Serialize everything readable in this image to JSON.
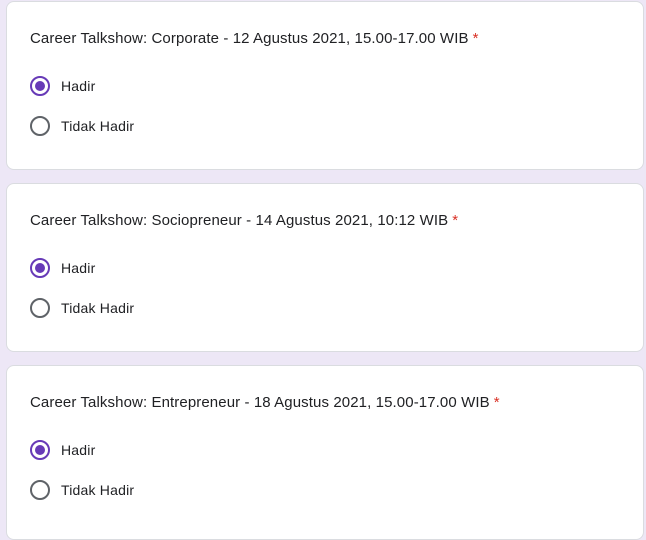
{
  "colors": {
    "accent": "#673ab7",
    "required": "#d93025",
    "background": "#ede7f6"
  },
  "questions": [
    {
      "title": "Career Talkshow: Corporate - 12 Agustus 2021, 15.00-17.00 WIB",
      "required_mark": "*",
      "options": [
        {
          "label": "Hadir",
          "selected": true
        },
        {
          "label": "Tidak Hadir",
          "selected": false
        }
      ]
    },
    {
      "title": "Career Talkshow: Sociopreneur - 14 Agustus 2021, 10:12 WIB",
      "required_mark": "*",
      "options": [
        {
          "label": "Hadir",
          "selected": true
        },
        {
          "label": "Tidak Hadir",
          "selected": false
        }
      ]
    },
    {
      "title": "Career Talkshow: Entrepreneur - 18 Agustus 2021, 15.00-17.00 WIB",
      "required_mark": "*",
      "options": [
        {
          "label": "Hadir",
          "selected": true
        },
        {
          "label": "Tidak Hadir",
          "selected": false
        }
      ]
    }
  ]
}
